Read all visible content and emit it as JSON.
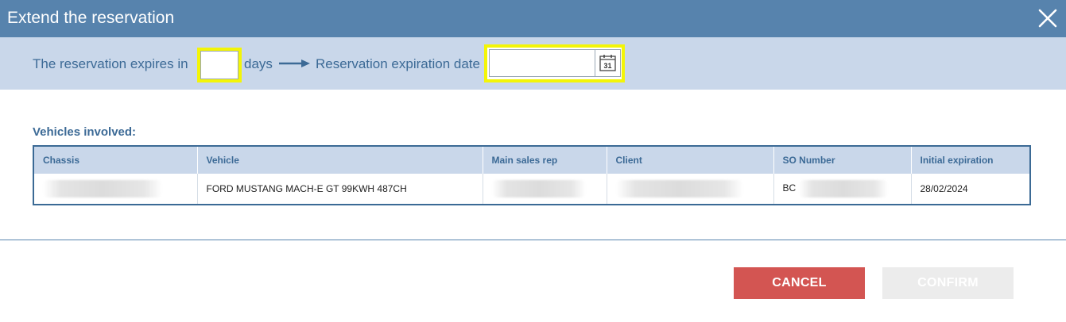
{
  "dialog": {
    "title": "Extend the reservation"
  },
  "extension": {
    "expires_prefix": "The reservation expires in",
    "days_value": "",
    "days_suffix": "days",
    "expiration_date_label": "Reservation expiration date",
    "expiration_date_value": "",
    "calendar_icon_text": "31"
  },
  "vehicles": {
    "section_label": "Vehicles involved:",
    "columns": [
      "Chassis",
      "Vehicle",
      "Main sales rep",
      "Client",
      "SO Number",
      "Initial expiration"
    ],
    "rows": [
      {
        "chassis": "",
        "vehicle": "FORD MUSTANG MACH-E GT 99KWH 487CH",
        "main_sales_rep": "",
        "client": "",
        "so_number_prefix": "BC",
        "initial_expiration": "28/02/2024"
      }
    ]
  },
  "footer": {
    "cancel_label": "CANCEL",
    "confirm_label": "CONFIRM"
  },
  "colors": {
    "titlebar": "#5783ad",
    "subbar": "#c9d7ea",
    "accent_text": "#3c6a96",
    "highlight": "#f3f507",
    "cancel_button": "#d35552",
    "confirm_button_disabled": "#ececec"
  },
  "icons": {
    "close": "close-icon",
    "arrow": "arrow-right-icon",
    "calendar": "calendar-icon"
  }
}
